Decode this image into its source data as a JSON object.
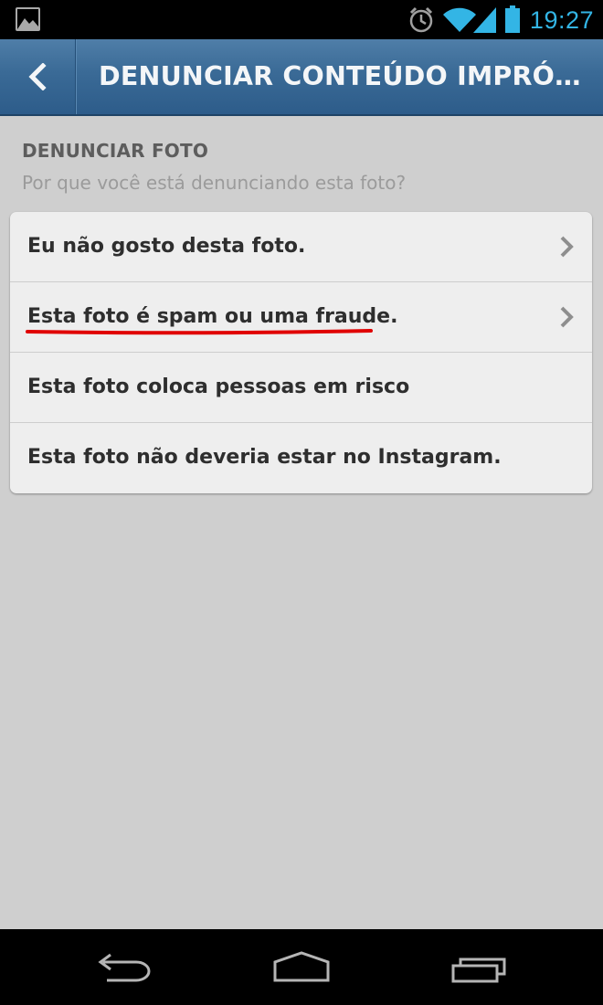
{
  "status_bar": {
    "time": "19:27",
    "icons": [
      "gallery-icon",
      "alarm-icon",
      "wifi-icon",
      "signal-icon",
      "battery-icon"
    ],
    "time_color": "#33b5e5"
  },
  "action_bar": {
    "title": "DENUNCIAR CONTEÚDO IMPRÓP...",
    "back_icon": "chevron-left-icon",
    "color": "#3a6a96"
  },
  "section": {
    "heading": "DENUNCIAR FOTO",
    "subtitle": "Por que você está denunciando esta foto?"
  },
  "options": [
    {
      "label": "Eu não gosto desta foto.",
      "has_chevron": true
    },
    {
      "label": "Esta foto é spam ou uma fraude.",
      "has_chevron": true,
      "annotation": "red-underline"
    },
    {
      "label": "Esta foto coloca pessoas em risco",
      "has_chevron": false
    },
    {
      "label": "Esta foto não deveria estar no Instagram.",
      "has_chevron": false
    }
  ],
  "annotation_color": "#e00000",
  "nav_bar": {
    "icons": [
      "back-arrow-icon",
      "home-icon",
      "recent-apps-icon"
    ]
  }
}
